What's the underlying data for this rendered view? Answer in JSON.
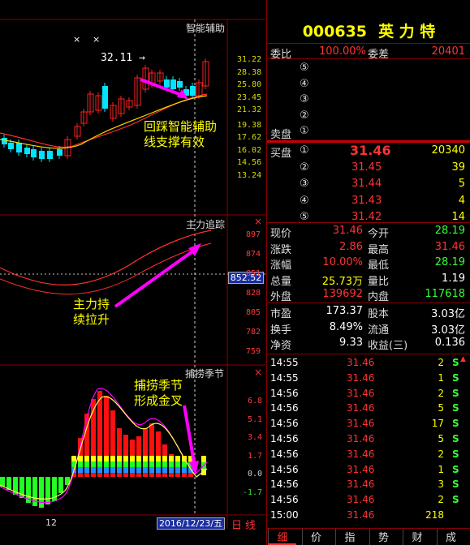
{
  "stock": {
    "code": "000635",
    "name": "英 力 特"
  },
  "commission": {
    "label1": "委比",
    "pct": "100.00%",
    "label2": "委差",
    "diff": "20401"
  },
  "sell": {
    "label": "卖盘",
    "levels": [
      {
        "n": "⑤"
      },
      {
        "n": "④"
      },
      {
        "n": "③"
      },
      {
        "n": "②"
      },
      {
        "n": "①"
      }
    ]
  },
  "buy": {
    "label": "买盘",
    "levels": [
      {
        "n": "①",
        "price": "31.46",
        "vol": "20340"
      },
      {
        "n": "②",
        "price": "31.45",
        "vol": "39"
      },
      {
        "n": "③",
        "price": "31.44",
        "vol": "5"
      },
      {
        "n": "④",
        "price": "31.43",
        "vol": "4"
      },
      {
        "n": "⑤",
        "price": "31.42",
        "vol": "14"
      }
    ]
  },
  "quote": [
    {
      "l1": "现价",
      "v1": "31.46",
      "c1": "red",
      "l2": "今开",
      "v2": "28.19",
      "c2": "green"
    },
    {
      "l1": "涨跌",
      "v1": "2.86",
      "c1": "red",
      "l2": "最高",
      "v2": "31.46",
      "c2": "red"
    },
    {
      "l1": "涨幅",
      "v1": "10.00%",
      "c1": "red",
      "l2": "最低",
      "v2": "28.19",
      "c2": "green"
    },
    {
      "l1": "总量",
      "v1": "25.73万",
      "c1": "yel",
      "l2": "量比",
      "v2": "1.19",
      "c2": "white"
    },
    {
      "l1": "外盘",
      "v1": "139692",
      "c1": "red",
      "l2": "内盘",
      "v2": "117618",
      "c2": "green"
    }
  ],
  "quote2": [
    {
      "l1": "市盈",
      "v1": "173.37",
      "l2": "股本",
      "v2": "3.03亿"
    },
    {
      "l1": "换手",
      "v1": "8.49%",
      "l2": "流通",
      "v2": "3.03亿"
    },
    {
      "l1": "净资",
      "v1": "9.33",
      "l2": "收益(三)",
      "v2": "0.136"
    }
  ],
  "ticks": [
    {
      "t": "14:55",
      "p": "31.46",
      "v": "2",
      "s": "S"
    },
    {
      "t": "14:55",
      "p": "31.46",
      "v": "1",
      "s": "S"
    },
    {
      "t": "14:56",
      "p": "31.46",
      "v": "2",
      "s": "S"
    },
    {
      "t": "14:56",
      "p": "31.46",
      "v": "5",
      "s": "S"
    },
    {
      "t": "14:56",
      "p": "31.46",
      "v": "17",
      "s": "S"
    },
    {
      "t": "14:56",
      "p": "31.46",
      "v": "5",
      "s": "S"
    },
    {
      "t": "14:56",
      "p": "31.46",
      "v": "2",
      "s": "S"
    },
    {
      "t": "14:56",
      "p": "31.46",
      "v": "1",
      "s": "S"
    },
    {
      "t": "14:56",
      "p": "31.46",
      "v": "3",
      "s": "S"
    },
    {
      "t": "14:56",
      "p": "31.46",
      "v": "2",
      "s": "S"
    },
    {
      "t": "15:00",
      "p": "31.46",
      "v": "218",
      "s": ""
    }
  ],
  "tabs": [
    "细",
    "价",
    "指",
    "势",
    "财",
    "成"
  ],
  "panels": {
    "main_title": "智能辅助",
    "main_axis": [
      "31.22",
      "28.38",
      "25.80",
      "23.45",
      "21.32",
      "19.38",
      "17.62",
      "16.02",
      "14.56",
      "13.24"
    ],
    "max_label": "32.11",
    "main_annotation_1": "回踩智能辅助",
    "main_annotation_2": "线支撑有效",
    "mid_title": "主力追踪",
    "mid_axis": [
      "897",
      "874",
      "851",
      "828",
      "805",
      "782",
      "759"
    ],
    "mid_cursor": "852.52",
    "mid_annotation_1": "主力持",
    "mid_annotation_2": "续拉升",
    "low_title": "捕捞季节",
    "low_axis": [
      "6.8",
      "5.1",
      "3.4",
      "1.7",
      "0.0",
      "-1.7"
    ],
    "low_annotation_1": "捕捞季节",
    "low_annotation_2": "形成金叉",
    "date": "2016/12/23/五",
    "period": "日线",
    "xlabel": "12"
  },
  "colors": {
    "up": "#ff2020",
    "down": "#00e5ff",
    "gold": "#ffd700",
    "magenta": "#ff00ff"
  }
}
